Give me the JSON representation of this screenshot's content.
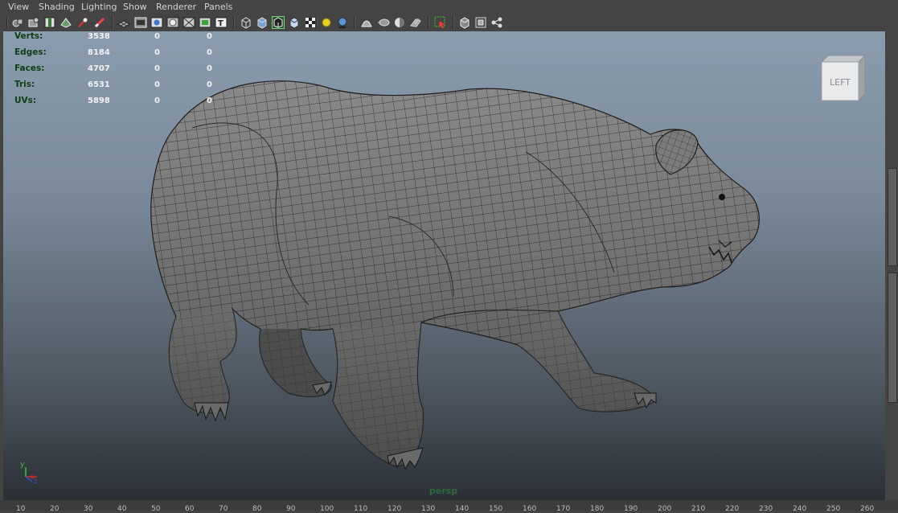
{
  "menu": {
    "items": [
      {
        "label": "View"
      },
      {
        "label": "Shading"
      },
      {
        "label": "Lighting"
      },
      {
        "label": "Show"
      },
      {
        "label": "Renderer"
      },
      {
        "label": "Panels"
      }
    ]
  },
  "toolbar": {
    "icons": [
      "select-camera-icon",
      "camera-attributes-icon",
      "bookmark-icon",
      "image-plane-icon",
      "two-d-pan-zoom-icon",
      "grease-pencil-icon",
      "grid-icon",
      "film-gate-icon",
      "resolution-gate-icon",
      "gate-mask-icon",
      "field-chart-icon",
      "title-safe-icon",
      "wireframe-icon",
      "smooth-shade-icon",
      "wireframe-on-shaded-icon",
      "default-material-icon",
      "textured-icon",
      "use-all-lights-icon",
      "shadows-icon",
      "screen-space-ambient-occlusion-icon",
      "motion-blur-icon",
      "multisample-aa-icon",
      "depth-of-field-icon",
      "isolate-select-icon",
      "xray-icon",
      "xray-joints-icon",
      "xray-components-icon"
    ]
  },
  "hud": {
    "rows": [
      {
        "label": "Verts:",
        "v1": "3538",
        "v2": "0",
        "v3": "0"
      },
      {
        "label": "Edges:",
        "v1": "8184",
        "v2": "0",
        "v3": "0"
      },
      {
        "label": "Faces:",
        "v1": "4707",
        "v2": "0",
        "v3": "0"
      },
      {
        "label": "Tris:",
        "v1": "6531",
        "v2": "0",
        "v3": "0"
      },
      {
        "label": "UVs:",
        "v1": "5898",
        "v2": "0",
        "v3": "0"
      }
    ]
  },
  "viewcube": {
    "label": "LEFT"
  },
  "axis": {
    "y": "y",
    "x": "x",
    "z": "z"
  },
  "camera": {
    "name": "persp"
  },
  "ruler": {
    "ticks": [
      "10",
      "20",
      "30",
      "40",
      "50",
      "60",
      "70",
      "80",
      "90",
      "100",
      "110",
      "120",
      "130",
      "140",
      "150",
      "160",
      "170",
      "180",
      "190",
      "200",
      "210",
      "220",
      "230",
      "240",
      "250",
      "260"
    ]
  },
  "colors": {
    "hud_label": "#0f3d14",
    "hud_value": "#f2f2f2",
    "axis_x": "#c83232",
    "axis_y": "#34c834",
    "axis_z": "#3050d0"
  }
}
